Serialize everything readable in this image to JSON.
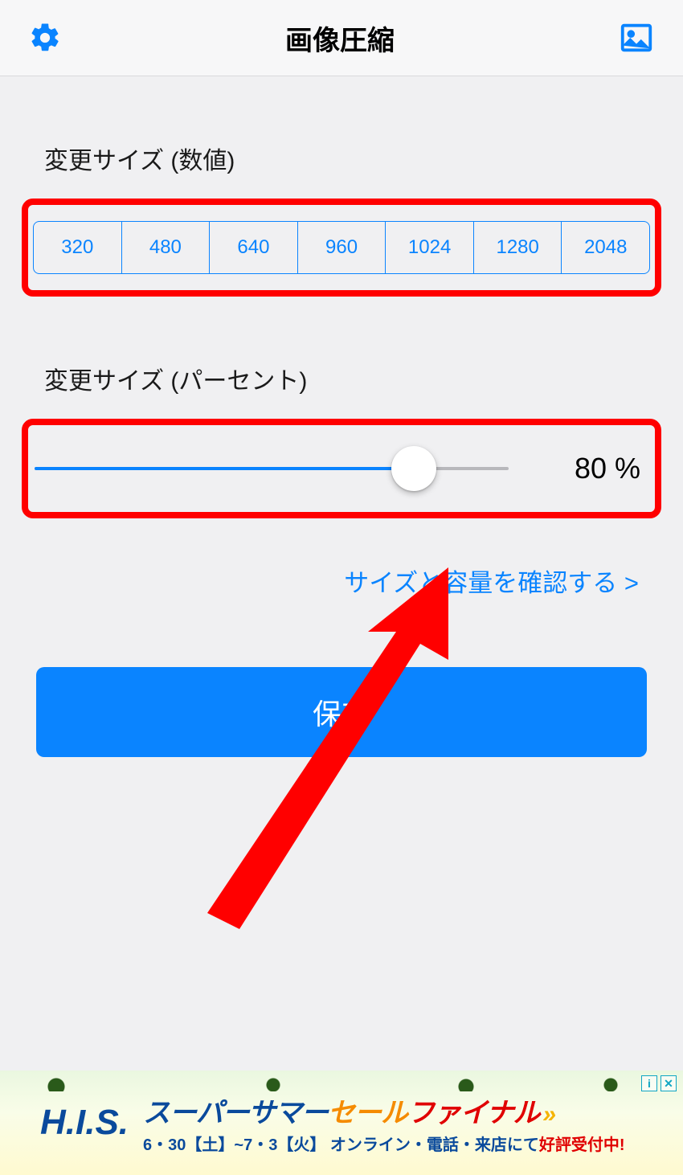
{
  "header": {
    "title": "画像圧縮"
  },
  "size_numeric": {
    "label": "変更サイズ (数値)",
    "options": [
      "320",
      "480",
      "640",
      "960",
      "1024",
      "1280",
      "2048"
    ]
  },
  "size_percent": {
    "label": "変更サイズ (パーセント)",
    "value_display": "80 %",
    "percent": 80
  },
  "check_link": "サイズと容量を確認する >",
  "save_button": "保存",
  "ad": {
    "logo": "H.I.S.",
    "line1_a": "スーパーサマー",
    "line1_b": "セール",
    "line1_c": "ファイナル",
    "line2_a": "6・30【土】~7・3【火】",
    "line2_b": "オンライン・電話・来店にて",
    "line2_c": "好評受付中!",
    "info": "i",
    "close": "✕"
  }
}
